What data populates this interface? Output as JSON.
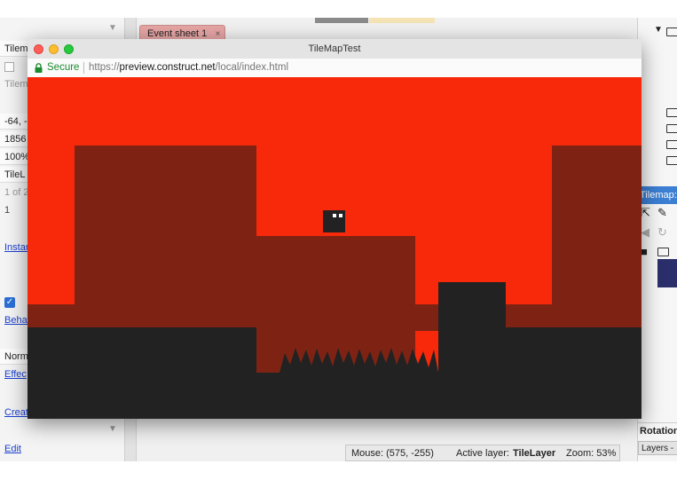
{
  "colors": {
    "sky": "#f7290a",
    "background_tiles": "#7e2314",
    "foreground_tiles": "#222222",
    "player": "#222222",
    "event_tab": "#e7a5a5",
    "tilemap_header": "#3c7fd3",
    "secure_green": "#1d8a2f",
    "link_blue": "#1a3fd1"
  },
  "editor": {
    "left_panel": {
      "object_name": "Tilem",
      "grey_label": "Tilem",
      "position": "-64, -",
      "size": "1856",
      "opacity": "100%",
      "layer": "TileL",
      "instance_of": "1 of 2",
      "uid": "1",
      "instance_link": "Instar",
      "behaviors_link": "Behav",
      "blend_mode": "Norm",
      "effects_link": "Effec",
      "create_link": "Creat",
      "edit_link": "Edit"
    },
    "tabs": [
      {
        "label": "Event sheet 1",
        "close": "×"
      }
    ],
    "right_panel": {
      "tilemap_header": "Tilemap:",
      "rotation_label": "Rotation",
      "layers_tab": "Layers -",
      "icons": [
        "folder-icon",
        "pointer-icon",
        "pencil-icon",
        "flip-icon",
        "rotate-icon",
        "save-icon"
      ]
    },
    "status": {
      "mouse": "Mouse: (575, -255)",
      "active_layer_label": "Active layer:",
      "active_layer_value": "TileLayer",
      "zoom": "Zoom: 53%"
    }
  },
  "preview_window": {
    "title": "TileMapTest",
    "secure_label": "Secure",
    "url_scheme": "https://",
    "url_host": "preview.construct.net",
    "url_path": "/local/index.html"
  }
}
